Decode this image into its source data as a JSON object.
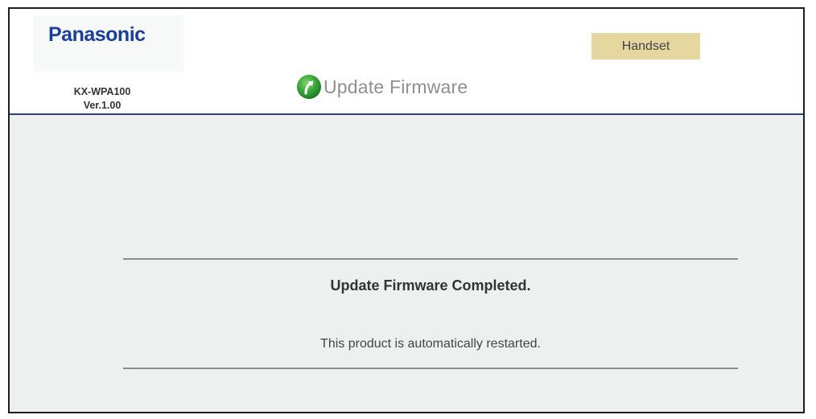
{
  "header": {
    "logo_text": "Panasonic",
    "model": "KX-WPA100",
    "version": "Ver.1.00",
    "handset_label": "Handset",
    "page_title": "Update Firmware"
  },
  "icons": {
    "title_icon": "update-arrow-icon"
  },
  "colors": {
    "logo": "#1a3f9a",
    "header_rule": "#2b3f86",
    "handset_button": "#e6d6a0",
    "icon_green": "#3aa83a",
    "content_bg": "#eef0f0"
  },
  "message": {
    "title": "Update Firmware Completed.",
    "detail": "This product is automatically restarted."
  }
}
